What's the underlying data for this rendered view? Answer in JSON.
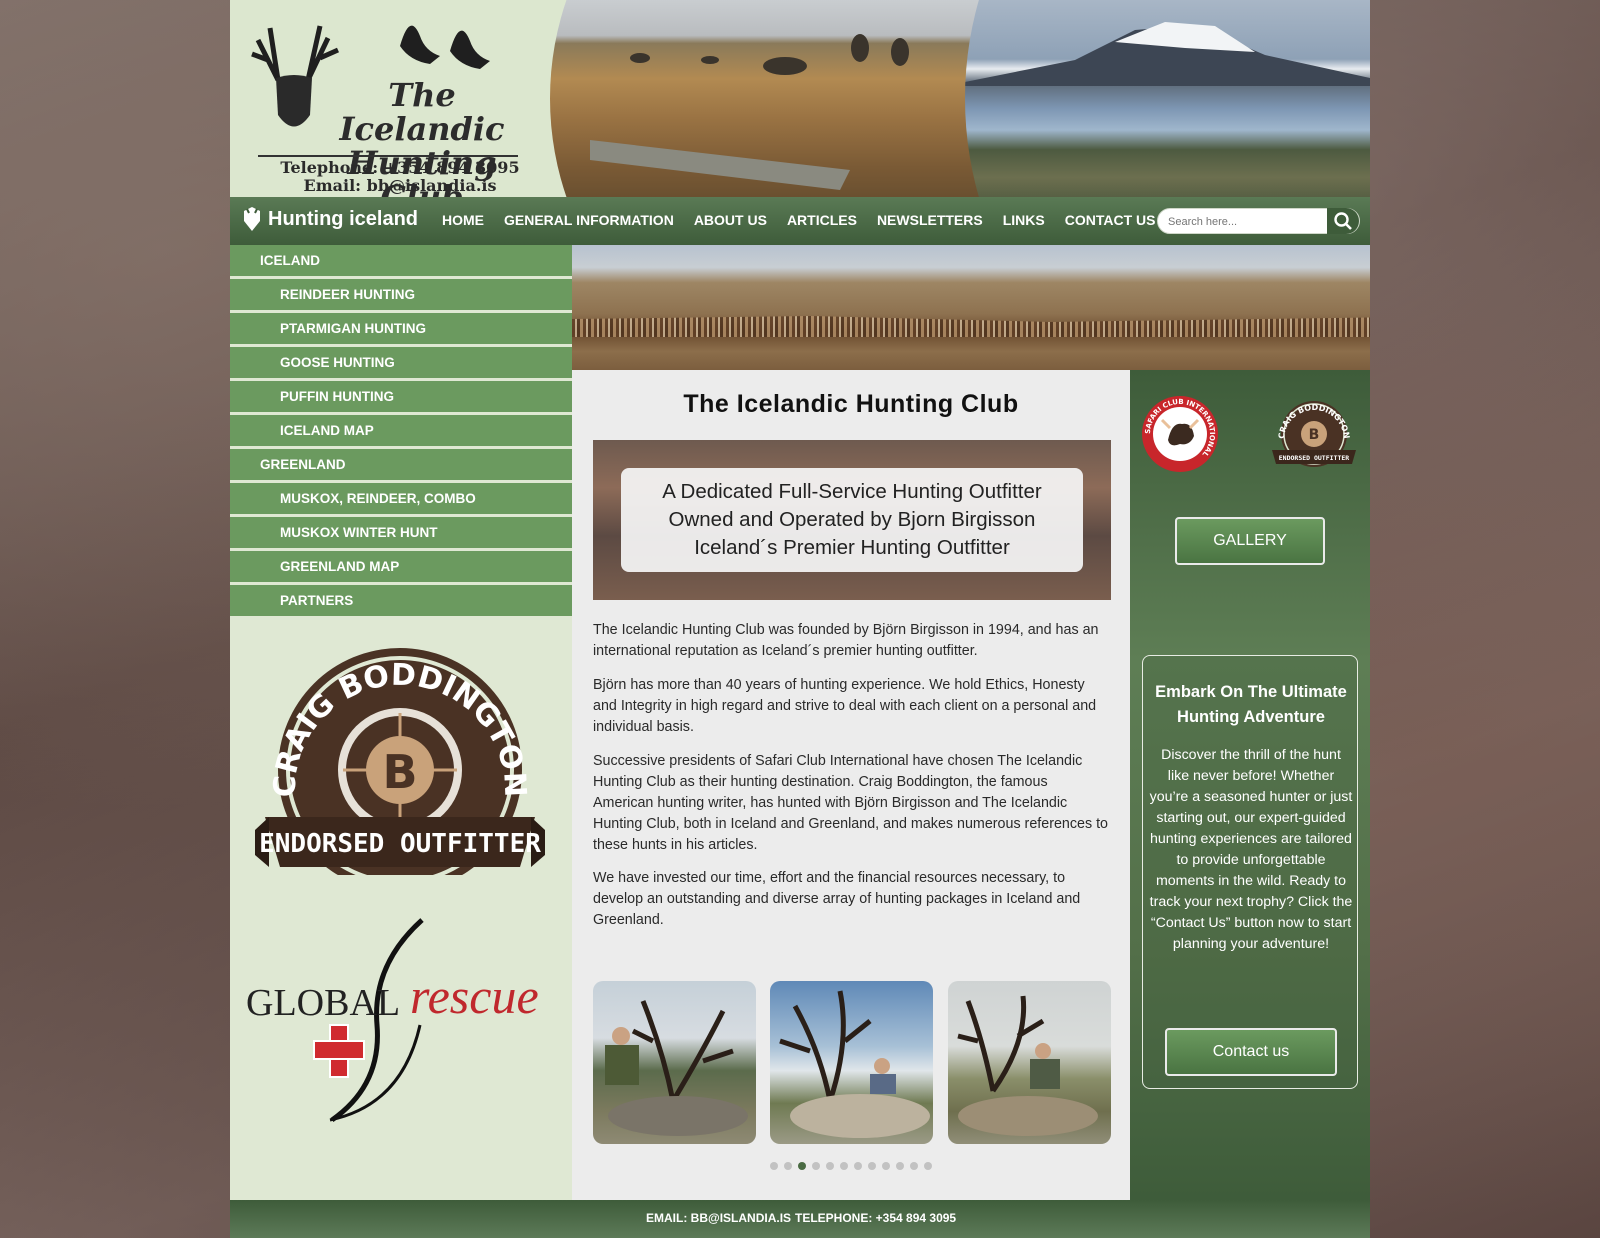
{
  "header": {
    "logo_title_line1": "The Icelandic",
    "logo_title_line2": "Hunting Club",
    "telephone": "Telephone: +354 894 3095",
    "email": "Email: bb@islandia.is"
  },
  "nav": {
    "brand": "Hunting iceland",
    "items": [
      "HOME",
      "GENERAL INFORMATION",
      "ABOUT US",
      "ARTICLES",
      "NEWSLETTERS",
      "LINKS",
      "CONTACT US"
    ],
    "search_placeholder": "Search here..."
  },
  "sidebar": {
    "items": [
      {
        "label": "ICELAND",
        "level": 1
      },
      {
        "label": "REINDEER HUNTING",
        "level": 2
      },
      {
        "label": "PTARMIGAN HUNTING",
        "level": 2
      },
      {
        "label": "GOOSE HUNTING",
        "level": 2
      },
      {
        "label": "PUFFIN HUNTING",
        "level": 2
      },
      {
        "label": "ICELAND MAP",
        "level": 2
      },
      {
        "label": "GREENLAND",
        "level": 1
      },
      {
        "label": "MUSKOX, REINDEER, COMBO",
        "level": 2
      },
      {
        "label": "MUSKOX WINTER HUNT",
        "level": 2
      },
      {
        "label": "GREENLAND MAP",
        "level": 2
      },
      {
        "label": "PARTNERS",
        "level": 2
      }
    ],
    "badge_top": "CRAIG BODDINGTON",
    "badge_letter": "B",
    "badge_bottom": "ENDORSED OUTFITTER",
    "rescue_global": "GLOBAL",
    "rescue_word": "rescue"
  },
  "main": {
    "title": "The  Icelandic  Hunting  Club",
    "banner_lines": [
      "A Dedicated Full-Service Hunting Outfitter",
      "Owned and Operated by Bjorn Birgisson",
      "Iceland´s Premier Hunting Outfitter"
    ],
    "paragraphs": [
      "The Icelandic Hunting Club was founded by Björn Birgisson in 1994, and has an international reputation as Iceland´s premier hunting outfitter.",
      "Björn has more than 40 years of hunting experience. We hold Ethics, Honesty and Integrity in high regard and strive to deal with each client on a personal and individual basis.",
      "Successive presidents of Safari Club International have chosen The Icelandic Hunting Club as their hunting destination. Craig Boddington, the famous American hunting writer, has hunted with Björn Birgisson and The Icelandic Hunting Club, both in Iceland and Greenland, and makes numerous references to these hunts in his articles.",
      "We have invested our time, effort and the financial resources necessary, to develop an outstanding and diverse array of hunting packages in Iceland and Greenland."
    ],
    "carousel_dot_count": 12,
    "carousel_active_index": 2
  },
  "right": {
    "sci_text": "SAFARI CLUB INTERNATIONAL",
    "cb_small_top": "CRAIG BODDINGTON",
    "cb_small_bottom": "ENDORSED OUTFITTER",
    "gallery_label": "GALLERY",
    "cta_title": "Embark On The Ultimate Hunting Adventure",
    "cta_text": "Discover the thrill of the hunt like never before! Whether you’re a seasoned hunter or just starting out, our expert-guided hunting experiences are tailored to provide unforgettable moments in the wild. Ready to track your next trophy? Click the “Contact Us” button now to start planning your adventure!",
    "contact_label": "Contact us"
  },
  "footer": {
    "email": "EMAIL: BB@ISLANDIA.IS",
    "telephone": "TELEPHONE: +354 894 3095"
  },
  "colors": {
    "nav_green": "#3e5c3a",
    "menu_green": "#6b9a5f",
    "sidebar_bg": "#dfe8d3",
    "content_bg": "#ececec"
  }
}
